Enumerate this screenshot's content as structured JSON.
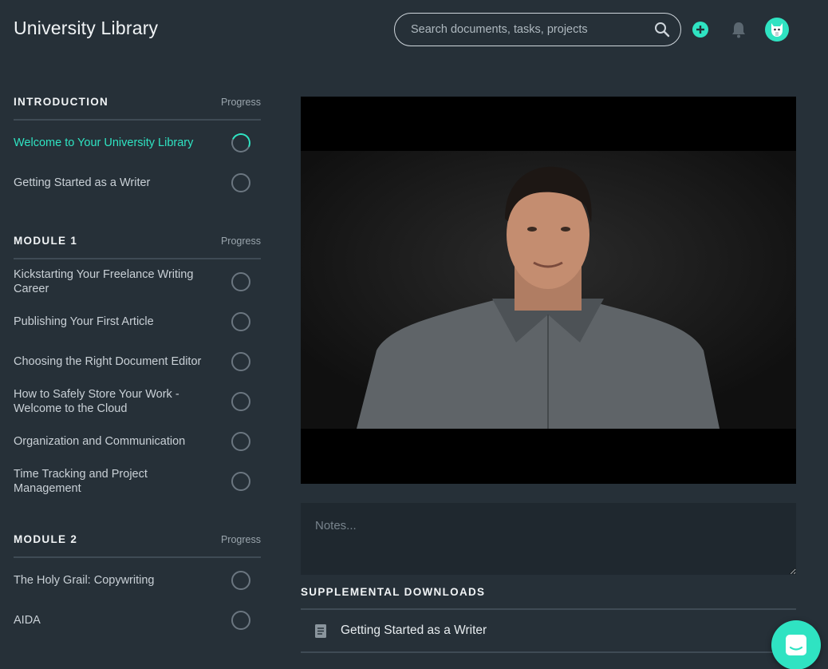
{
  "header": {
    "title": "University Library",
    "search_placeholder": "Search documents, tasks, projects"
  },
  "sections": [
    {
      "title": "INTRODUCTION",
      "progress_label": "Progress",
      "lessons": [
        {
          "label": "Welcome to Your University Library",
          "active": true
        },
        {
          "label": "Getting Started as a Writer",
          "active": false
        }
      ]
    },
    {
      "title": "MODULE 1",
      "progress_label": "Progress",
      "lessons": [
        {
          "label": "Kickstarting Your Freelance Writing Career",
          "active": false
        },
        {
          "label": "Publishing Your First Article",
          "active": false
        },
        {
          "label": "Choosing the Right Document Editor",
          "active": false
        },
        {
          "label": "How to Safely Store Your Work - Welcome to the Cloud",
          "active": false
        },
        {
          "label": "Organization and Communication",
          "active": false
        },
        {
          "label": "Time Tracking and Project Management",
          "active": false
        }
      ]
    },
    {
      "title": "MODULE 2",
      "progress_label": "Progress",
      "lessons": [
        {
          "label": "The Holy Grail: Copywriting",
          "active": false
        },
        {
          "label": "AIDA",
          "active": false
        }
      ]
    }
  ],
  "notes": {
    "placeholder": "Notes..."
  },
  "downloads": {
    "title": "SUPPLEMENTAL DOWNLOADS",
    "items": [
      {
        "label": "Getting Started as a Writer"
      }
    ]
  },
  "colors": {
    "accent": "#2fe3c2",
    "background": "#263038"
  }
}
